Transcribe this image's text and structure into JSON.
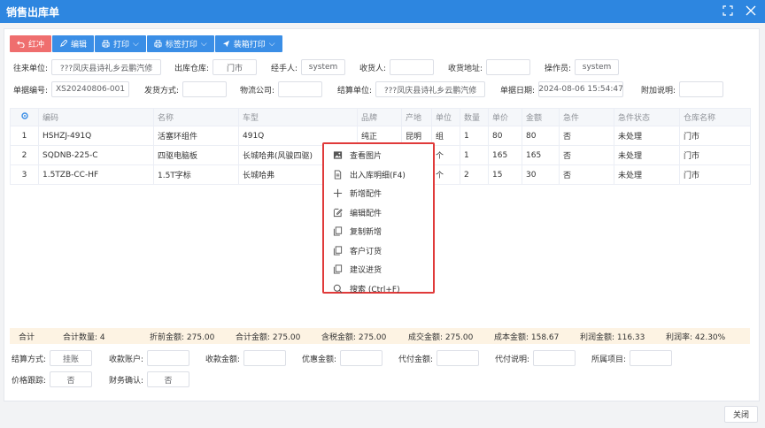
{
  "window": {
    "title": "销售出库单"
  },
  "toolbar": {
    "buttons": [
      {
        "label": "红冲",
        "icon": "undo-icon"
      },
      {
        "label": "编辑",
        "icon": "edit-icon"
      },
      {
        "label": "打印",
        "icon": "printer-icon",
        "dropdown": true
      },
      {
        "label": "标签打印",
        "icon": "printer-icon",
        "dropdown": true
      },
      {
        "label": "装箱打印",
        "icon": "send-icon",
        "dropdown": true
      }
    ]
  },
  "form": {
    "partner_label": "往来单位:",
    "partner_value": "???凤庆县诗礼乡云鹏汽修",
    "warehouse_label": "出库仓库:",
    "warehouse_value": "门市",
    "handler_label": "经手人:",
    "handler_value": "system",
    "receiver_label": "收货人:",
    "receiver_value": "",
    "address_label": "收货地址:",
    "address_value": "",
    "operator_label": "操作员:",
    "operator_value": "system",
    "docno_label": "单据编号:",
    "docno_value": "XS20240806-001",
    "ship_label": "发货方式:",
    "ship_value": "",
    "logistics_label": "物流公司:",
    "logistics_value": "",
    "settle_label": "结算单位:",
    "settle_value": "???凤庆县诗礼乡云鹏汽修",
    "date_label": "单据日期:",
    "date_value": "2024-08-06 15:54:47",
    "note_label": "附加说明:",
    "note_value": ""
  },
  "table": {
    "headers": [
      "",
      "编码",
      "名称",
      "车型",
      "品牌",
      "产地",
      "单位",
      "数量",
      "单价",
      "金额",
      "急件",
      "急件状态",
      "仓库名称"
    ],
    "rows": [
      [
        "1",
        "HSHZJ-491Q",
        "活塞环组件",
        "491Q",
        "纯正",
        "昆明",
        "组",
        "1",
        "80",
        "80",
        "否",
        "未处理",
        "门市"
      ],
      [
        "2",
        "SQDNB-225-C",
        "四驱电脑板",
        "长城哈弗(风骏四驱)",
        "",
        "",
        "个",
        "1",
        "165",
        "165",
        "否",
        "未处理",
        "门市"
      ],
      [
        "3",
        "1.5TZB-CC-HF",
        "1.5T字标",
        "长城哈弗",
        "",
        "",
        "个",
        "2",
        "15",
        "30",
        "否",
        "未处理",
        "门市"
      ]
    ]
  },
  "context_menu": {
    "items": [
      {
        "label": "查看图片",
        "icon": "image-icon"
      },
      {
        "label": "出入库明细(F4)",
        "icon": "document-icon"
      },
      {
        "label": "新增配件",
        "icon": "plus-icon"
      },
      {
        "label": "编辑配件",
        "icon": "edit-icon"
      },
      {
        "label": "复制新增",
        "icon": "copy-icon"
      },
      {
        "label": "客户订货",
        "icon": "copy-icon"
      },
      {
        "label": "建议进货",
        "icon": "copy-icon"
      },
      {
        "label": "搜索 (Ctrl+F)",
        "icon": "search-icon"
      }
    ]
  },
  "summary": {
    "total": "合计",
    "qty": "合计数量: 4",
    "pre_discount": "折前金额: 275.00",
    "total_amount": "合计金额: 275.00",
    "tax_amount": "含税金额: 275.00",
    "deal_amount": "成交金额: 275.00",
    "cost_amount": "成本金额: 158.67",
    "profit_amount": "利润金额: 116.33",
    "profit_rate": "利润率: 42.30%"
  },
  "footer_form": {
    "settle_method_label": "结算方式:",
    "settle_method_value": "挂账",
    "account_label": "收款账户:",
    "account_value": "",
    "received_label": "收款金额:",
    "received_value": "",
    "discount_label": "优惠金额:",
    "discount_value": "",
    "proxy_amount_label": "代付金额:",
    "proxy_amount_value": "",
    "proxy_note_label": "代付说明:",
    "proxy_note_value": "",
    "project_label": "所属项目:",
    "project_value": "",
    "price_track_label": "价格跟踪:",
    "price_track_value": "否",
    "finance_label": "财务确认:",
    "finance_value": "否"
  },
  "close_label": "关闭",
  "colors": {
    "accent": "#2d86e0",
    "danger": "#ef6e6e",
    "summary_bg": "#fdf3e3",
    "highlight": "#e03a3a"
  }
}
